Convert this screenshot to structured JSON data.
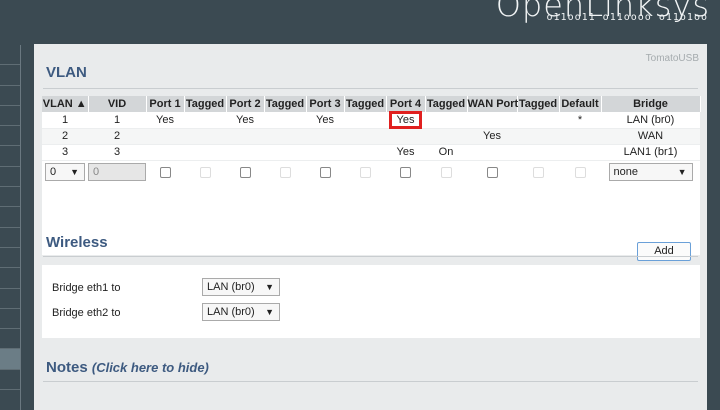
{
  "header": {
    "brand": "OpenLinksys",
    "brand_bits": "o11oo11 o11oooo o11o1oo"
  },
  "panel": {
    "badge": "TomatoUSB"
  },
  "vlan": {
    "title": "VLAN",
    "columns": [
      "VLAN ▲",
      "VID",
      "Port 1",
      "Tagged",
      "Port 2",
      "Tagged",
      "Port 3",
      "Tagged",
      "Port 4",
      "Tagged",
      "WAN Port",
      "Tagged",
      "Default",
      "Bridge"
    ],
    "rows": [
      [
        "1",
        "1",
        "Yes",
        "",
        "Yes",
        "",
        "Yes",
        "",
        "Yes",
        "",
        "",
        "",
        "*",
        "LAN (br0)"
      ],
      [
        "2",
        "2",
        "",
        "",
        "",
        "",
        "",
        "",
        "",
        "",
        "Yes",
        "",
        "",
        "WAN"
      ],
      [
        "3",
        "3",
        "",
        "",
        "",
        "",
        "",
        "",
        "Yes",
        "On",
        "",
        "",
        "",
        "LAN1 (br1)"
      ]
    ],
    "new_row": {
      "vlan_select": "0",
      "vid_value": "0",
      "bridge_select": "none"
    },
    "add_label": "Add"
  },
  "wireless": {
    "title": "Wireless",
    "items": [
      {
        "label": "Bridge eth1 to",
        "value": "LAN (br0)"
      },
      {
        "label": "Bridge eth2 to",
        "value": "LAN (br0)"
      }
    ]
  },
  "notes": {
    "title": "Notes",
    "link": "(Click here to hide)"
  }
}
